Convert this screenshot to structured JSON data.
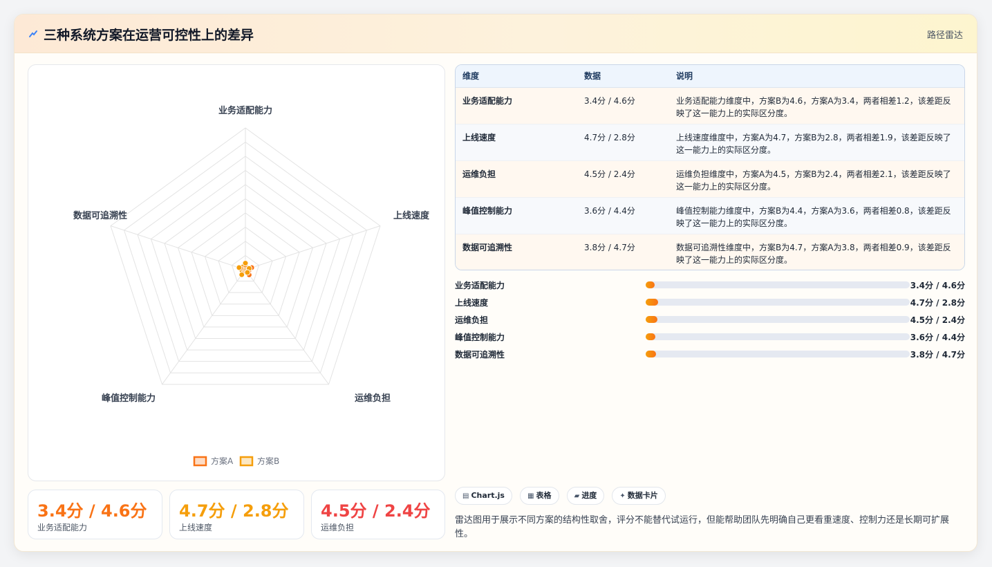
{
  "header": {
    "title": "三种系统方案在运营可控性上的差异",
    "tag": "路径雷达"
  },
  "chart_data": {
    "type": "radar",
    "axes": [
      "业务适配能力",
      "上线速度",
      "运维负担",
      "峰值控制能力",
      "数据可追溯性"
    ],
    "rlim": [
      0,
      100
    ],
    "gridlines": 10,
    "series": [
      {
        "name": "方案A",
        "values": [
          3.4,
          4.7,
          4.5,
          3.6,
          3.8
        ],
        "color": "#f97316"
      },
      {
        "name": "方案B",
        "values": [
          4.6,
          2.8,
          2.4,
          4.4,
          4.7
        ],
        "color": "#f59e0b"
      }
    ],
    "legend": "bottom"
  },
  "kpis": [
    {
      "value": "3.4分 / 4.6分",
      "label": "业务适配能力",
      "color": "#f97316"
    },
    {
      "value": "4.7分 / 2.8分",
      "label": "上线速度",
      "color": "#f59e0b"
    },
    {
      "value": "4.5分 / 2.4分",
      "label": "运维负担",
      "color": "#ef4444"
    }
  ],
  "table": {
    "headers": [
      "维度",
      "数据",
      "说明"
    ],
    "rows": [
      {
        "dim": "业务适配能力",
        "data": "3.4分 / 4.6分",
        "desc": "业务适配能力维度中，方案B为4.6，方案A为3.4，两者相差1.2，该差距反映了这一能力上的实际区分度。"
      },
      {
        "dim": "上线速度",
        "data": "4.7分 / 2.8分",
        "desc": "上线速度维度中，方案A为4.7，方案B为2.8，两者相差1.9，该差距反映了这一能力上的实际区分度。"
      },
      {
        "dim": "运维负担",
        "data": "4.5分 / 2.4分",
        "desc": "运维负担维度中，方案A为4.5，方案B为2.4，两者相差2.1，该差距反映了这一能力上的实际区分度。"
      },
      {
        "dim": "峰值控制能力",
        "data": "3.6分 / 4.4分",
        "desc": "峰值控制能力维度中，方案B为4.4，方案A为3.6，两者相差0.8，该差距反映了这一能力上的实际区分度。"
      },
      {
        "dim": "数据可追溯性",
        "data": "3.8分 / 4.7分",
        "desc": "数据可追溯性维度中，方案B为4.7，方案A为3.8，两者相差0.9，该差距反映了这一能力上的实际区分度。"
      }
    ]
  },
  "bars": [
    {
      "label": "业务适配能力",
      "value": "3.4分 / 4.6分",
      "fill_pct": 3.4
    },
    {
      "label": "上线速度",
      "value": "4.7分 / 2.8分",
      "fill_pct": 4.7
    },
    {
      "label": "运维负担",
      "value": "4.5分 / 2.4分",
      "fill_pct": 4.5
    },
    {
      "label": "峰值控制能力",
      "value": "3.6分 / 4.4分",
      "fill_pct": 3.6
    },
    {
      "label": "数据可追溯性",
      "value": "3.8分 / 4.7分",
      "fill_pct": 3.8
    }
  ],
  "chips": [
    {
      "icon": "chart-icon",
      "glyph": "▤",
      "label": "Chart.js"
    },
    {
      "icon": "table-icon",
      "glyph": "▦",
      "label": "表格"
    },
    {
      "icon": "progress-icon",
      "glyph": "▰",
      "label": "进度"
    },
    {
      "icon": "sparkle-icon",
      "glyph": "✦",
      "label": "数据卡片"
    }
  ],
  "note": "雷达图用于展示不同方案的结构性取舍，评分不能替代试运行，但能帮助团队先明确自己更看重速度、控制力还是长期可扩展性。"
}
